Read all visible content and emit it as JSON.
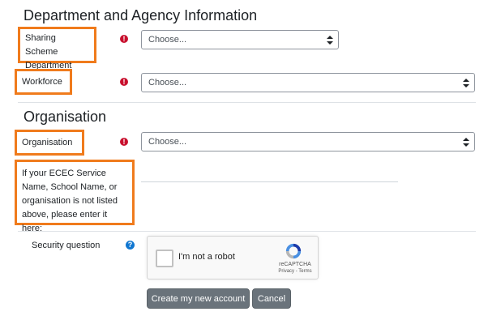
{
  "department_section": {
    "heading": "Department and Agency Information",
    "fields": [
      {
        "label": "Sharing Scheme Department",
        "value": "Choose..."
      },
      {
        "label": "Workforce",
        "value": "Choose..."
      }
    ]
  },
  "organisation_section": {
    "heading": "Organisation",
    "organisation_field": {
      "label": "Organisation",
      "value": "Choose..."
    },
    "other_field": {
      "label": "If your ECEC Service Name, School Name, or organisation is not listed above, please enter it here:",
      "value": ""
    }
  },
  "security": {
    "label": "Security question",
    "recaptcha": {
      "checkbox_label": "I'm not a robot",
      "brand": "reCAPTCHA",
      "links": "Privacy - Terms"
    }
  },
  "actions": {
    "create_label": "Create my new account",
    "cancel_label": "Cancel"
  },
  "icons": {
    "required": "required-exclamation-icon",
    "help": "question-circle-icon",
    "caret": "select-caret-icon"
  },
  "colors": {
    "highlight": "#f07b1c",
    "required": "#c8102e",
    "help": "#1177d1",
    "button": "#6a737b"
  }
}
